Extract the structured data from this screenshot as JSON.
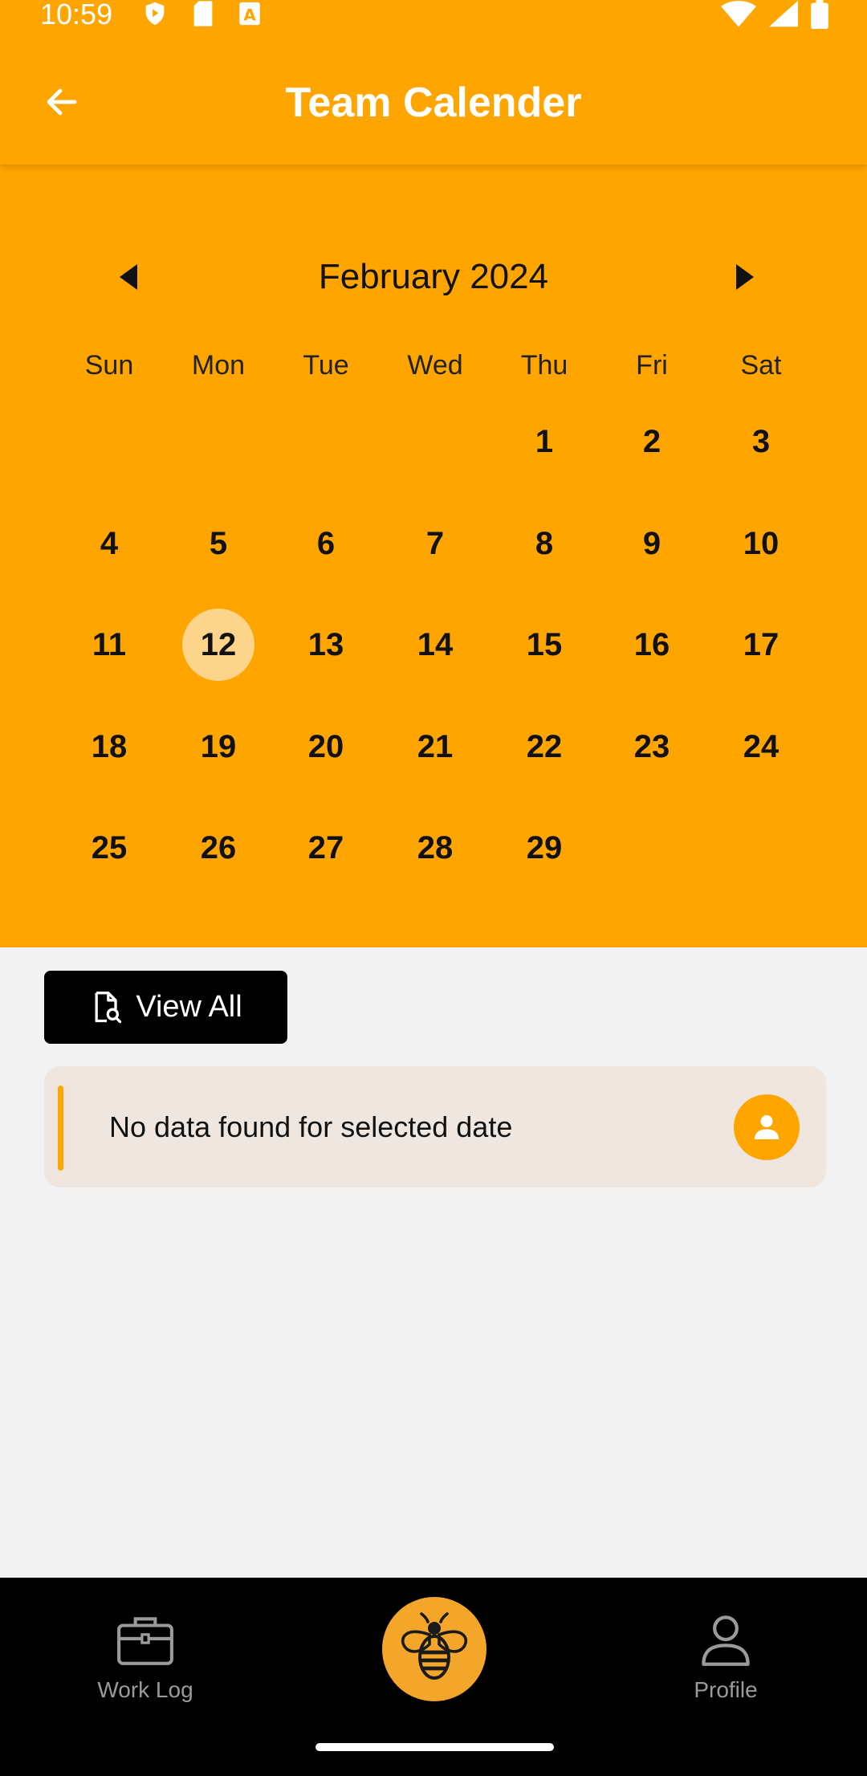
{
  "status_bar": {
    "time": "10:59",
    "left_icons": [
      "shield-play-icon",
      "sd-card-icon",
      "a-font-icon"
    ],
    "right_icons": [
      "wifi-icon",
      "signal-icon",
      "battery-icon"
    ]
  },
  "app_bar": {
    "title": "Team Calender",
    "back_icon": "arrow-left-icon"
  },
  "calendar": {
    "month_label": "February 2024",
    "weekdays": [
      "Sun",
      "Mon",
      "Tue",
      "Wed",
      "Thu",
      "Fri",
      "Sat"
    ],
    "first_weekday_index": 4,
    "days": [
      "1",
      "2",
      "3",
      "4",
      "5",
      "6",
      "7",
      "8",
      "9",
      "10",
      "11",
      "12",
      "13",
      "14",
      "15",
      "16",
      "17",
      "18",
      "19",
      "20",
      "21",
      "22",
      "23",
      "24",
      "25",
      "26",
      "27",
      "28",
      "29"
    ],
    "selected_day": "12"
  },
  "view_all": {
    "label": "View All",
    "icon": "document-search-icon"
  },
  "empty_state": {
    "message": "No data found for selected date",
    "icon": "person-icon"
  },
  "bottom_nav": {
    "items": [
      {
        "label": "Work Log",
        "icon": "briefcase-icon"
      },
      {
        "label": "",
        "icon": "bee-logo-icon"
      },
      {
        "label": "Profile",
        "icon": "person-outline-icon"
      }
    ]
  },
  "colors": {
    "accent": "#FFA500",
    "selected_day": "#FCD58A",
    "card_background": "#EEE6DF",
    "nav_background": "#000000"
  }
}
